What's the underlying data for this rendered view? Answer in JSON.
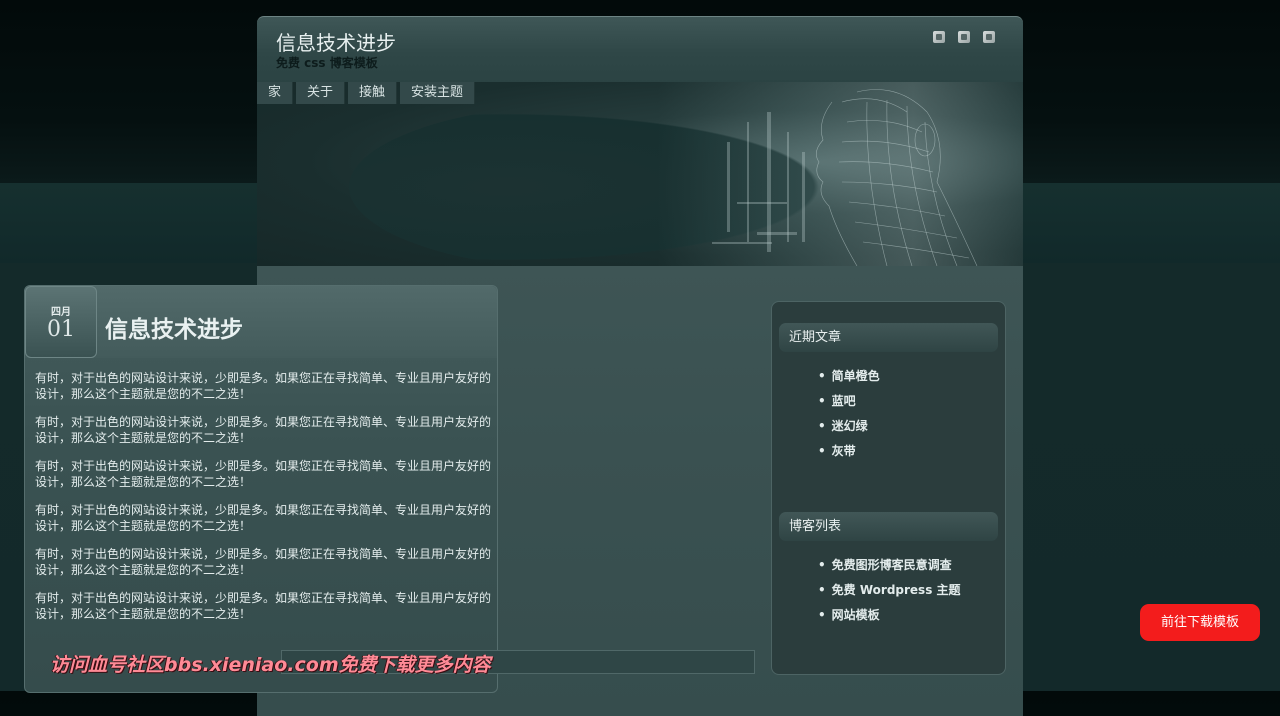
{
  "header": {
    "title": "信息技术进步",
    "subtitle": "免费 css 博客模板",
    "icons": [
      "bookmark-icon",
      "rss-icon",
      "mail-icon"
    ]
  },
  "nav": {
    "items": [
      {
        "label": "家"
      },
      {
        "label": "关于"
      },
      {
        "label": "接触"
      },
      {
        "label": "安装主题"
      }
    ]
  },
  "post": {
    "date": {
      "month": "四月",
      "day": "01"
    },
    "title": "信息技术进步",
    "paragraphs": [
      "有时，对于出色的网站设计来说，少即是多。如果您正在寻找简单、专业且用户友好的设计，那么这个主题就是您的不二之选！",
      "有时，对于出色的网站设计来说，少即是多。如果您正在寻找简单、专业且用户友好的设计，那么这个主题就是您的不二之选！",
      "有时，对于出色的网站设计来说，少即是多。如果您正在寻找简单、专业且用户友好的设计，那么这个主题就是您的不二之选！",
      "有时，对于出色的网站设计来说，少即是多。如果您正在寻找简单、专业且用户友好的设计，那么这个主题就是您的不二之选！",
      "有时，对于出色的网站设计来说，少即是多。如果您正在寻找简单、专业且用户友好的设计，那么这个主题就是您的不二之选！",
      "有时，对于出色的网站设计来说，少即是多。如果您正在寻找简单、专业且用户友好的设计，那么这个主题就是您的不二之选！"
    ]
  },
  "sidebar": {
    "recent": {
      "title": "近期文章",
      "items": [
        "简单橙色",
        "蓝吧",
        "迷幻绿",
        "灰带"
      ]
    },
    "blogroll": {
      "title": "博客列表",
      "items": [
        "免费图形博客民意调查",
        "免费 Wordpress 主题",
        "网站模板"
      ]
    }
  },
  "download_button": "前往下载模板",
  "watermark": "访问血号社区bbs.xieniao.com免费下载更多内容"
}
